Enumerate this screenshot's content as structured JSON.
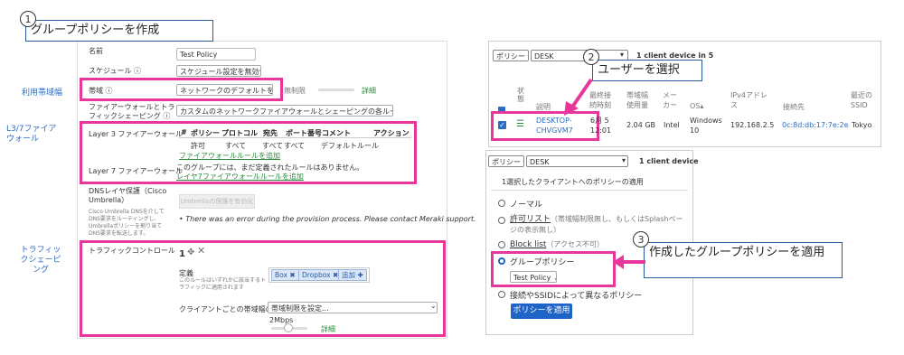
{
  "callouts": {
    "c1": {
      "num": "1",
      "text": "グループポリシーを作成"
    },
    "c2": {
      "num": "2",
      "text": "ユーザーを選択"
    },
    "c3": {
      "num": "3",
      "text": "作成したグループポリシーを適用"
    }
  },
  "left_labels": {
    "bandwidth": "利用帯域幅",
    "l37": "L3/7ファイアウォール",
    "traffic": "トラフィックシェーピング"
  },
  "policy_form": {
    "name_label": "名前",
    "name_value": "Test Policy",
    "schedule_label": "スケジュール",
    "schedule_value": "スケジュール設定を無効化",
    "bandwidth_label": "帯域",
    "bandwidth_value": "ネットワークのデフォルトを使用",
    "bandwidth_unlimited": "無制限",
    "bandwidth_detail": "詳細",
    "fw_shaping_label": "ファイアーウォールとトラフィックシェーピング",
    "fw_shaping_value": "カスタムのネットワークファイアウォールとシェーピングの各ルールを作成",
    "l3_label": "Layer 3 ファイアーウォール",
    "l3_headers": [
      "#",
      "ポリシー",
      "プロトコル",
      "宛先",
      "ポート番号",
      "コメント",
      "アクション"
    ],
    "l3_row": [
      "許可",
      "すべて",
      "すべて",
      "すべて",
      "デフォルトルール"
    ],
    "l3_add": "ファイアウォールルールを追加",
    "l7_label": "Layer 7 ファイアーウォール",
    "l7_text": "このグループには、まだ定義されたルールはありません。",
    "l7_add": "レイヤ7ファイアウォールルールを追加",
    "dns_label": "DNSレイヤ保護（Cisco Umbrella）",
    "dns_button": "Umbrellaの保護を有効化",
    "dns_desc": "Cisco Umbrella DNSを介してDNS要求をルーティングし、Umbrellaポリシーを割り当てDNS要求を転送します。",
    "dns_error": "There was an error during the provision process. Please contact Meraki support.",
    "traffic_label": "トラフィックコントロール",
    "traffic_num": "1",
    "category_label": "定義",
    "category_desc": "このルールはいずれかに該当するトラフィックに適用されます",
    "tags": [
      "Box",
      "Dropbox"
    ],
    "tag_add": "追加",
    "client_bw_label": "クライアントごとの帯域幅の制限",
    "client_bw_value": "帯域制限を設定...",
    "slider_value": "2Mbps",
    "slider_detail": "詳細"
  },
  "client_list": {
    "policy_button": "ポリシー",
    "search_value": "DESK",
    "count_text": "1 client device in 5",
    "headers": [
      "状態",
      "説明",
      "最終接続時刻",
      "帯域幅使用量",
      "メーカー",
      "OS",
      "IPv4アドレス",
      "接続先",
      "最近のSSID"
    ],
    "row": {
      "description": "DESKTOP-CHVGVM7",
      "last_seen": "6月 5 12:01",
      "usage": "2.04 GB",
      "manufacturer": "Intel",
      "os": "Windows 10",
      "ip": "192.168.2.5",
      "mac": "0c:8d:db:17:7e:2e",
      "ssid": "Tokyo"
    }
  },
  "policy_menu": {
    "policy_button": "ポリシー",
    "search_value": "DESK",
    "count_text": "1 client device",
    "title": "1選択したクライアントへのポリシーの適用",
    "options": [
      {
        "label": "ノーマル",
        "note": ""
      },
      {
        "label": "許可リスト",
        "note": "（帯域幅制限無し、もしくはSplashページの表示無し）"
      },
      {
        "label": "Block list",
        "note": "（アクセス不可）"
      },
      {
        "label": "グループポリシー",
        "note": ""
      },
      {
        "label": "接続やSSIDによって異なるポリシー",
        "note": ""
      }
    ],
    "group_value": "Test Policy",
    "apply_button": "ポリシーを適用"
  }
}
